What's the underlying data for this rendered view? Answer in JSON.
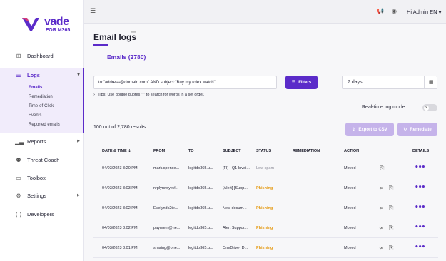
{
  "brand": {
    "name": "vade",
    "product": "FOR M365",
    "accent": "#5b2bc9"
  },
  "sidebar": {
    "items": [
      {
        "label": "Dashboard",
        "icon": "grid-icon"
      },
      {
        "label": "Logs",
        "icon": "list-icon"
      },
      {
        "label": "Reports",
        "icon": "bar-chart-icon"
      },
      {
        "label": "Threat Coach",
        "icon": "coach-icon"
      },
      {
        "label": "Toolbox",
        "icon": "toolbox-icon"
      },
      {
        "label": "Settings",
        "icon": "gear-icon"
      },
      {
        "label": "Developers",
        "icon": "code-icon"
      }
    ],
    "logs_subitems": [
      "Emails",
      "Remediation",
      "Time-of-Click",
      "Events",
      "Reported emails"
    ]
  },
  "topbar": {
    "user_label": "Hi Admin EN"
  },
  "page": {
    "title": "Email logs",
    "tab_label": "Emails (2780)"
  },
  "query": {
    "text": "to:\"address@domain.com\" AND subject:\"Buy my rolex watch\"",
    "filters_label": "Filters",
    "period": "7 days",
    "tips": "Tips:  Use double quotes \" \" to search for words in a set order."
  },
  "realtime_label": "Real-time log mode",
  "results_label": "100 out of 2,780 results",
  "buttons": {
    "export": "Export to CSV",
    "remediate": "Remediate"
  },
  "table": {
    "headers": [
      "DATE & TIME",
      "FROM",
      "TO",
      "SUBJECT",
      "STATUS",
      "REMEDIATION",
      "ACTION",
      "DETAILS"
    ],
    "rows": [
      {
        "date": "04/03/2023 3:20 PM",
        "from": "mark.spence...",
        "to": "legitdo365.u...",
        "subject": "[FI] - Q1 Invoi...",
        "status": "Low spam",
        "action": "Moved",
        "link": false
      },
      {
        "date": "04/03/2023 3:03 PM",
        "from": "nrplyrcvryxvl...",
        "to": "legitdo365.u...",
        "subject": "[Alert] [Supp...",
        "status": "Phishing",
        "action": "Moved",
        "link": true
      },
      {
        "date": "04/03/2023 3:02 PM",
        "from": "Evelyndk2te...",
        "to": "legitdo365.u...",
        "subject": "New docum...",
        "status": "Phishing",
        "action": "Moved",
        "link": true
      },
      {
        "date": "04/03/2023 3:02 PM",
        "from": "payment@ne...",
        "to": "legitdo365.u...",
        "subject": "Alert Suppor...",
        "status": "Phishing",
        "action": "Moved",
        "link": true
      },
      {
        "date": "04/03/2023 3:01 PM",
        "from": "sharing@one...",
        "to": "legitdo365.u...",
        "subject": "OneDrive- D...",
        "status": "Phishing",
        "action": "Moved",
        "link": true
      }
    ]
  }
}
